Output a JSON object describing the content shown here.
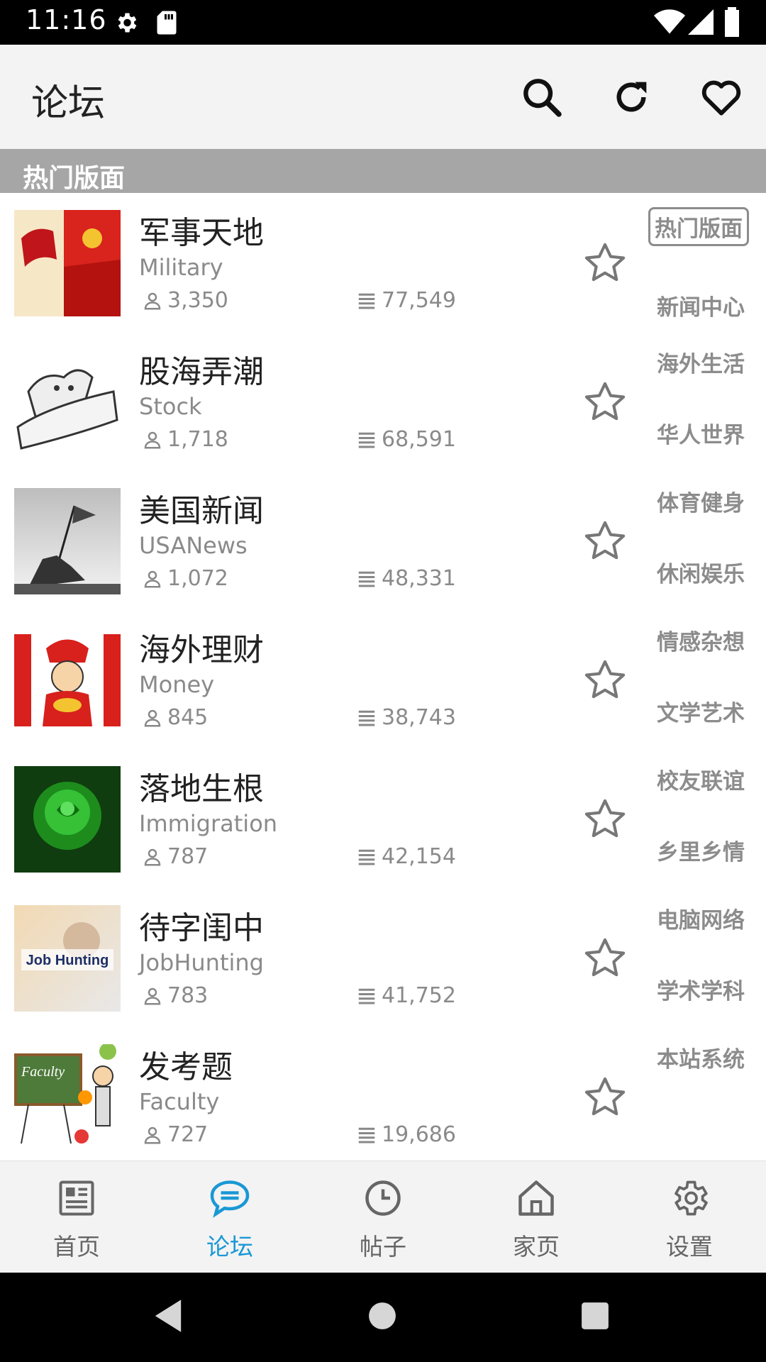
{
  "status_bar": {
    "time": "11:16"
  },
  "app_bar": {
    "title": "论坛",
    "actions": [
      "search-icon",
      "refresh-icon",
      "heart-icon"
    ]
  },
  "section": {
    "title": "热门版面"
  },
  "forums": [
    {
      "name": "军事天地",
      "en": "Military",
      "users": "3,350",
      "posts": "77,549"
    },
    {
      "name": "股海弄潮",
      "en": "Stock",
      "users": "1,718",
      "posts": "68,591"
    },
    {
      "name": "美国新闻",
      "en": "USANews",
      "users": "1,072",
      "posts": "48,331"
    },
    {
      "name": "海外理财",
      "en": "Money",
      "users": "845",
      "posts": "38,743"
    },
    {
      "name": "落地生根",
      "en": "Immigration",
      "users": "787",
      "posts": "42,154"
    },
    {
      "name": "待字闺中",
      "en": "JobHunting",
      "users": "783",
      "posts": "41,752"
    },
    {
      "name": "发考题",
      "en": "Faculty",
      "users": "727",
      "posts": "19,686"
    }
  ],
  "categories": [
    "热门版面",
    "新闻中心",
    "海外生活",
    "华人世界",
    "体育健身",
    "休闲娱乐",
    "情感杂想",
    "文学艺术",
    "校友联谊",
    "乡里乡情",
    "电脑网络",
    "学术学科",
    "本站系统"
  ],
  "thumbnail_texts": {
    "job_hunting": "Job Hunting",
    "faculty": "Faculty"
  },
  "bottom_nav": [
    {
      "label": "首页",
      "icon": "newspaper-icon"
    },
    {
      "label": "论坛",
      "icon": "chat-bubble-icon",
      "active": true
    },
    {
      "label": "帖子",
      "icon": "clock-icon"
    },
    {
      "label": "家页",
      "icon": "home-icon"
    },
    {
      "label": "设置",
      "icon": "gear-icon"
    }
  ],
  "colors": {
    "accent": "#1a98d5",
    "section_bg": "#a6a6a6",
    "app_bar_bg": "#f3f3f3"
  }
}
